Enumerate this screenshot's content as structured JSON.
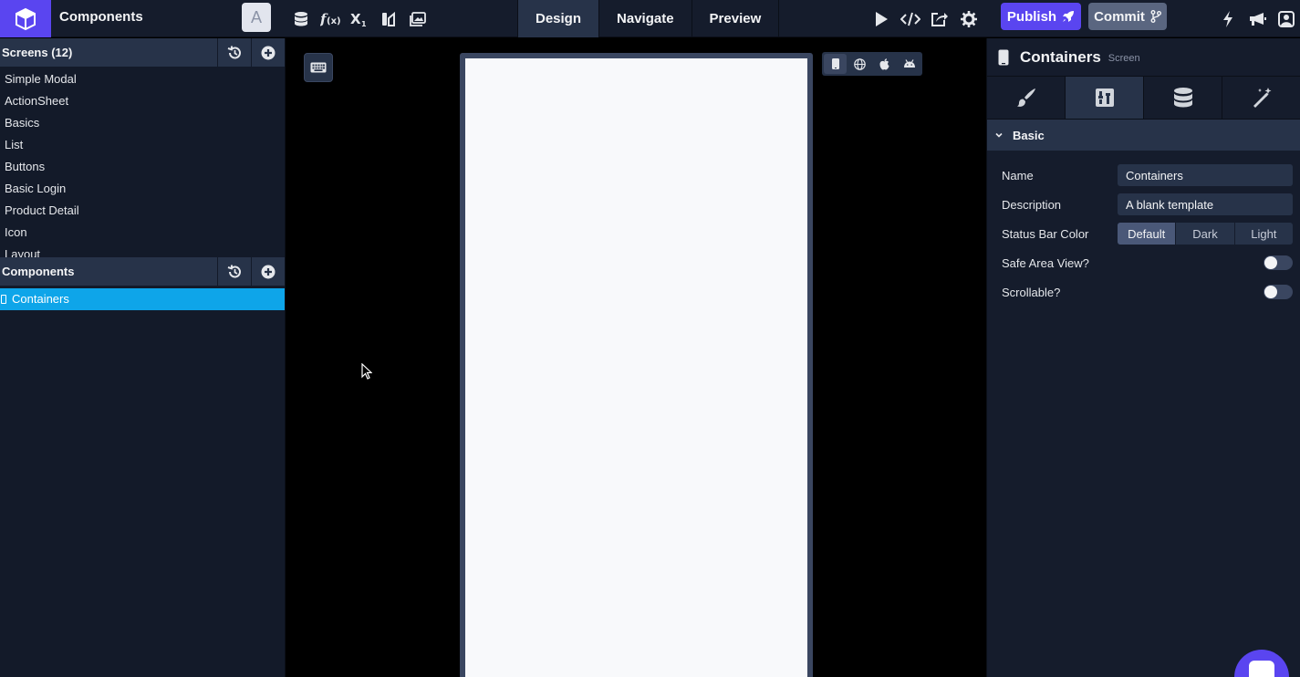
{
  "app": {
    "title": "Components",
    "avatar_letter": "A"
  },
  "modes": [
    {
      "label": "Design",
      "active": true
    },
    {
      "label": "Navigate",
      "active": false
    },
    {
      "label": "Preview",
      "active": false
    }
  ],
  "toolbar": {
    "publish_label": "Publish",
    "commit_label": "Commit",
    "tool_icons": [
      "database-icon",
      "function-icon",
      "subscript-icon",
      "translate-icon",
      "image-gallery-icon"
    ],
    "right_icons": [
      "play-icon",
      "code-icon",
      "share-icon",
      "gear-icon"
    ],
    "far_icons": [
      "bolt-icon",
      "megaphone-icon",
      "user-icon"
    ]
  },
  "sidebar": {
    "screens_header": "Screens (12)",
    "screens": [
      {
        "label": "Simple Modal"
      },
      {
        "label": "ActionSheet"
      },
      {
        "label": "Basics"
      },
      {
        "label": "List"
      },
      {
        "label": "Buttons"
      },
      {
        "label": "Basic Login"
      },
      {
        "label": "Product Detail"
      },
      {
        "label": "Icon"
      },
      {
        "label": "Layout"
      }
    ],
    "components_header": "Components",
    "components": [
      {
        "label": "Containers",
        "selected": true
      }
    ]
  },
  "properties": {
    "title": "Containers",
    "subtitle": "Screen",
    "section": "Basic",
    "name_label": "Name",
    "name_value": "Containers",
    "description_label": "Description",
    "description_value": "A blank template",
    "status_bar_label": "Status Bar Color",
    "status_bar_options": [
      "Default",
      "Dark",
      "Light"
    ],
    "status_bar_selected": "Default",
    "safe_area_label": "Safe Area View?",
    "safe_area_on": false,
    "scrollable_label": "Scrollable?",
    "scrollable_on": false
  },
  "colors": {
    "brand": "#5a45f0",
    "selection": "#0ea5e9",
    "panel": "#151c2c",
    "header": "#273349"
  }
}
